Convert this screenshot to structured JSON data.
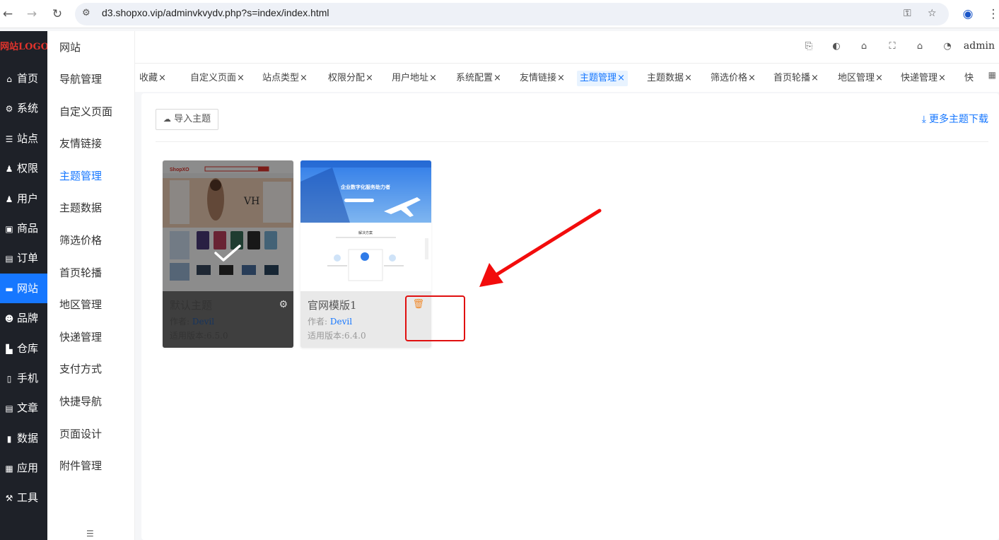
{
  "browser": {
    "url": "d3.shopxo.vip/adminvkvydv.php?s=index/index.html",
    "back_icon": "arrow-left-icon",
    "forward_icon": "arrow-right-icon",
    "reload_icon": "reload-icon"
  },
  "app": {
    "logo_text": "网站LOGO",
    "left_nav": [
      {
        "label": "首页",
        "icon": "home-icon"
      },
      {
        "label": "系统",
        "icon": "gear-icon"
      },
      {
        "label": "站点",
        "icon": "sliders-icon"
      },
      {
        "label": "权限",
        "icon": "user-lock-icon"
      },
      {
        "label": "用户",
        "icon": "user-icon"
      },
      {
        "label": "商品",
        "icon": "goods-icon"
      },
      {
        "label": "订单",
        "icon": "order-icon"
      },
      {
        "label": "网站",
        "icon": "site-icon",
        "active": true
      },
      {
        "label": "品牌",
        "icon": "brand-icon"
      },
      {
        "label": "仓库",
        "icon": "warehouse-icon"
      },
      {
        "label": "手机",
        "icon": "phone-icon"
      },
      {
        "label": "文章",
        "icon": "article-icon"
      },
      {
        "label": "数据",
        "icon": "chart-icon"
      },
      {
        "label": "应用",
        "icon": "apps-icon"
      },
      {
        "label": "工具",
        "icon": "wrench-icon"
      }
    ],
    "sub_nav_title": "网站",
    "sub_nav": [
      "导航管理",
      "自定义页面",
      "友情链接",
      "主题管理",
      "主题数据",
      "筛选价格",
      "首页轮播",
      "地区管理",
      "快递管理",
      "支付方式",
      "快捷导航",
      "页面设计",
      "附件管理"
    ],
    "sub_nav_active": "主题管理",
    "user": "admin",
    "tabs": [
      "收藏",
      "自定义页面",
      "站点类型",
      "权限分配",
      "用户地址",
      "系统配置",
      "友情链接",
      "主题管理",
      "主题数据",
      "筛选价格",
      "首页轮播",
      "地区管理",
      "快递管理",
      "快"
    ],
    "active_tab": "主题管理"
  },
  "content": {
    "import_button": "导入主题",
    "more_link": "更多主题下载",
    "themes": [
      {
        "name": "默认主题",
        "author_label": "作者:",
        "author": "Devil",
        "version_label": "适用版本:",
        "version": "6.5.0",
        "selected": true
      },
      {
        "name": "官网模版1",
        "author_label": "作者:",
        "author": "Devil",
        "version_label": "适用版本:",
        "version": "6.4.0",
        "selected": false
      }
    ],
    "thumb_text": {
      "shop_logo": "ShopXO",
      "vh": "VH",
      "banner_title": "企业数字化服务助力者",
      "solution_title": "解决方案"
    }
  },
  "colors": {
    "accent": "#1677ff",
    "sidebar_bg": "#1e2128",
    "annotation_red": "#e01010"
  }
}
